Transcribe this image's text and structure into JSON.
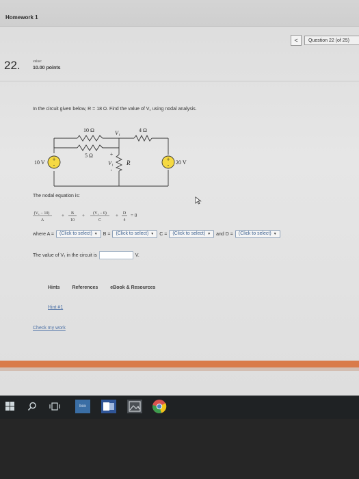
{
  "header": {
    "title": "Homework 1"
  },
  "nav": {
    "prev_label": "<",
    "question_label": "Question 22 (of 25)"
  },
  "question": {
    "number": "22.",
    "value_label": "value:",
    "points": "10.00 points",
    "prompt": "In the circuit given below, R = 18 Ω. Find the value of V₁ using nodal analysis."
  },
  "circuit": {
    "r_top_left": "10 Ω",
    "r_mid": "5 Ω",
    "r_top_right": "4 Ω",
    "node_label": "V₁",
    "v_label": "V₁",
    "r_label": "R",
    "src_left": "10 V",
    "src_right": "20 V",
    "plus": "+",
    "minus": "-"
  },
  "nodal": {
    "label": "The nodal equation is:"
  },
  "equation": {
    "t1_num": "(V₁ − 10)",
    "t1_den": "A",
    "plus": "+",
    "t2_num": "B",
    "t2_den": "10",
    "t3_num": "(V₁ − 0)",
    "t3_den": "C",
    "t4_num": "D",
    "t4_den": "4",
    "eq": "= 0"
  },
  "selects": {
    "where_label": "where A =",
    "a_value": "(Click to select)",
    "b_label": "B =",
    "b_value": "(Click to select)",
    "c_label": "C =",
    "c_value": "(Click to select)",
    "d_label": "and D =",
    "d_value": "(Click to select)"
  },
  "answer": {
    "label": "The value of V₁ in the circuit is",
    "value": "",
    "unit": "V."
  },
  "tabs": [
    "Hints",
    "References",
    "eBook & Resources"
  ],
  "links": {
    "hint": "Hint #1",
    "check": "Check my work"
  },
  "taskbar": {
    "box_label": "box"
  },
  "colors": {
    "accent_orange": "#d97b4a",
    "link_blue": "#4a6fa5",
    "taskbar": "#1f2224"
  }
}
